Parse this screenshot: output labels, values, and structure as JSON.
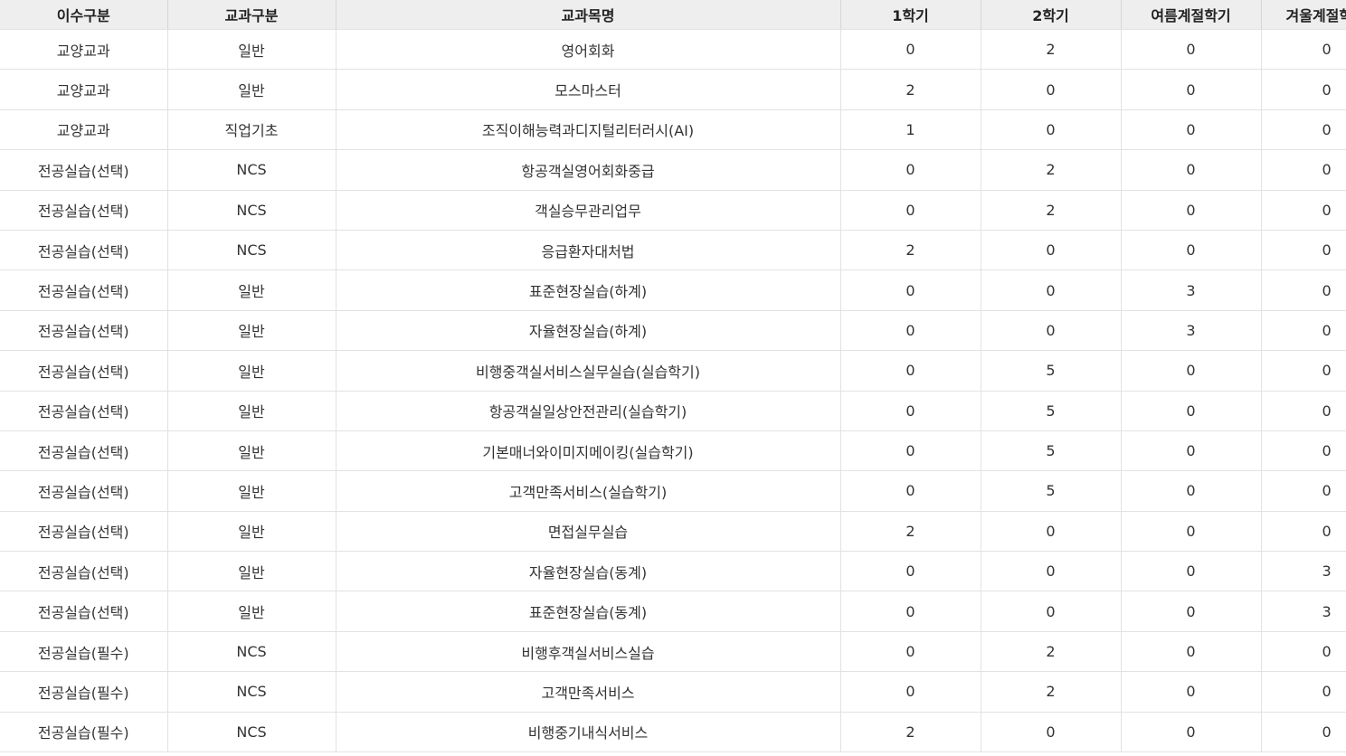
{
  "table": {
    "headers": [
      "이수구분",
      "교과구분",
      "교과목명",
      "1학기",
      "2학기",
      "여름계절학기",
      "겨울계절학기"
    ],
    "rows": [
      [
        "교양교과",
        "일반",
        "영어회화",
        "0",
        "2",
        "0",
        "0"
      ],
      [
        "교양교과",
        "일반",
        "모스마스터",
        "2",
        "0",
        "0",
        "0"
      ],
      [
        "교양교과",
        "직업기초",
        "조직이해능력과디지털리터러시(AI)",
        "1",
        "0",
        "0",
        "0"
      ],
      [
        "전공실습(선택)",
        "NCS",
        "항공객실영어회화중급",
        "0",
        "2",
        "0",
        "0"
      ],
      [
        "전공실습(선택)",
        "NCS",
        "객실승무관리업무",
        "0",
        "2",
        "0",
        "0"
      ],
      [
        "전공실습(선택)",
        "NCS",
        "응급환자대처법",
        "2",
        "0",
        "0",
        "0"
      ],
      [
        "전공실습(선택)",
        "일반",
        "표준현장실습(하계)",
        "0",
        "0",
        "3",
        "0"
      ],
      [
        "전공실습(선택)",
        "일반",
        "자율현장실습(하계)",
        "0",
        "0",
        "3",
        "0"
      ],
      [
        "전공실습(선택)",
        "일반",
        "비행중객실서비스실무실습(실습학기)",
        "0",
        "5",
        "0",
        "0"
      ],
      [
        "전공실습(선택)",
        "일반",
        "항공객실일상안전관리(실습학기)",
        "0",
        "5",
        "0",
        "0"
      ],
      [
        "전공실습(선택)",
        "일반",
        "기본매너와이미지메이킹(실습학기)",
        "0",
        "5",
        "0",
        "0"
      ],
      [
        "전공실습(선택)",
        "일반",
        "고객만족서비스(실습학기)",
        "0",
        "5",
        "0",
        "0"
      ],
      [
        "전공실습(선택)",
        "일반",
        "면접실무실습",
        "2",
        "0",
        "0",
        "0"
      ],
      [
        "전공실습(선택)",
        "일반",
        "자율현장실습(동계)",
        "0",
        "0",
        "0",
        "3"
      ],
      [
        "전공실습(선택)",
        "일반",
        "표준현장실습(동계)",
        "0",
        "0",
        "0",
        "3"
      ],
      [
        "전공실습(필수)",
        "NCS",
        "비행후객실서비스실습",
        "0",
        "2",
        "0",
        "0"
      ],
      [
        "전공실습(필수)",
        "NCS",
        "고객만족서비스",
        "0",
        "2",
        "0",
        "0"
      ],
      [
        "전공실습(필수)",
        "NCS",
        "비행중기내식서비스",
        "2",
        "0",
        "0",
        "0"
      ]
    ]
  }
}
